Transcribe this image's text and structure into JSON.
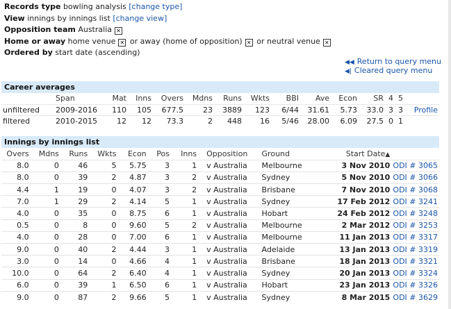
{
  "query": {
    "records_type": {
      "label": "Records type",
      "value": "bowling analysis",
      "link": "[change type]"
    },
    "view": {
      "label": "View",
      "value": "innings by innings list",
      "link": "[change view]"
    },
    "opposition": {
      "label": "Opposition team",
      "value": "Australia"
    },
    "home_away": {
      "label": "Home or away",
      "options": [
        "home venue",
        "or away (home of opposition)",
        "or neutral venue"
      ]
    },
    "ordered": {
      "label": "Ordered by",
      "value": "start date (ascending)"
    },
    "return_link": "Return to query menu",
    "cleared_link": "Cleared query menu"
  },
  "career": {
    "title": "Career averages",
    "headers": [
      "",
      "Span",
      "Mat",
      "Inns",
      "Overs",
      "Mdns",
      "Runs",
      "Wkts",
      "BBI",
      "Ave",
      "Econ",
      "SR",
      "4",
      "5",
      ""
    ],
    "rows": [
      [
        "unfiltered",
        "2009-2016",
        "110",
        "105",
        "677.5",
        "23",
        "3889",
        "123",
        "6/44",
        "31.61",
        "5.73",
        "33.0",
        "3",
        "3",
        "Profile"
      ],
      [
        "filtered",
        "2010-2015",
        "12",
        "12",
        "73.3",
        "2",
        "448",
        "16",
        "5/46",
        "28.00",
        "6.09",
        "27.5",
        "0",
        "1",
        ""
      ]
    ]
  },
  "innings": {
    "title": "Innings by innings list",
    "headers": [
      "Overs",
      "Mdns",
      "Runs",
      "Wkts",
      "Econ",
      "Pos",
      "Inns",
      "Opposition",
      "Ground",
      "Start Date",
      ""
    ],
    "sort_indicator": "▲",
    "rows": [
      [
        "8.0",
        "0",
        "46",
        "5",
        "5.75",
        "3",
        "1",
        "v Australia",
        "Melbourne",
        "3 Nov 2010",
        "ODI # 3065"
      ],
      [
        "8.0",
        "0",
        "39",
        "2",
        "4.87",
        "3",
        "2",
        "v Australia",
        "Sydney",
        "5 Nov 2010",
        "ODI # 3066"
      ],
      [
        "4.4",
        "1",
        "19",
        "0",
        "4.07",
        "3",
        "2",
        "v Australia",
        "Brisbane",
        "7 Nov 2010",
        "ODI # 3068"
      ],
      [
        "7.0",
        "1",
        "29",
        "2",
        "4.14",
        "5",
        "1",
        "v Australia",
        "Sydney",
        "17 Feb 2012",
        "ODI # 3241"
      ],
      [
        "4.0",
        "0",
        "35",
        "0",
        "8.75",
        "6",
        "1",
        "v Australia",
        "Hobart",
        "24 Feb 2012",
        "ODI # 3248"
      ],
      [
        "0.5",
        "0",
        "8",
        "0",
        "9.60",
        "5",
        "2",
        "v Australia",
        "Melbourne",
        "2 Mar 2012",
        "ODI # 3253"
      ],
      [
        "4.0",
        "0",
        "28",
        "0",
        "7.00",
        "6",
        "1",
        "v Australia",
        "Melbourne",
        "11 Jan 2013",
        "ODI # 3317"
      ],
      [
        "9.0",
        "0",
        "40",
        "2",
        "4.44",
        "3",
        "1",
        "v Australia",
        "Adelaide",
        "13 Jan 2013",
        "ODI # 3319"
      ],
      [
        "3.0",
        "0",
        "14",
        "0",
        "4.66",
        "4",
        "1",
        "v Australia",
        "Brisbane",
        "18 Jan 2013",
        "ODI # 3321"
      ],
      [
        "10.0",
        "0",
        "64",
        "2",
        "6.40",
        "4",
        "1",
        "v Australia",
        "Sydney",
        "20 Jan 2013",
        "ODI # 3324"
      ],
      [
        "6.0",
        "0",
        "39",
        "1",
        "6.50",
        "6",
        "1",
        "v Australia",
        "Hobart",
        "23 Jan 2013",
        "ODI # 3326"
      ],
      [
        "9.0",
        "0",
        "87",
        "2",
        "9.66",
        "5",
        "1",
        "v Australia",
        "Sydney",
        "8 Mar 2015",
        "ODI # 3629"
      ]
    ]
  },
  "icons": {
    "checkbox_x": "☒",
    "return": "◀◀",
    "cleared": "◀|"
  },
  "colors": {
    "link": "#1a55a8",
    "section_header_bg": "#d8eaf8"
  }
}
